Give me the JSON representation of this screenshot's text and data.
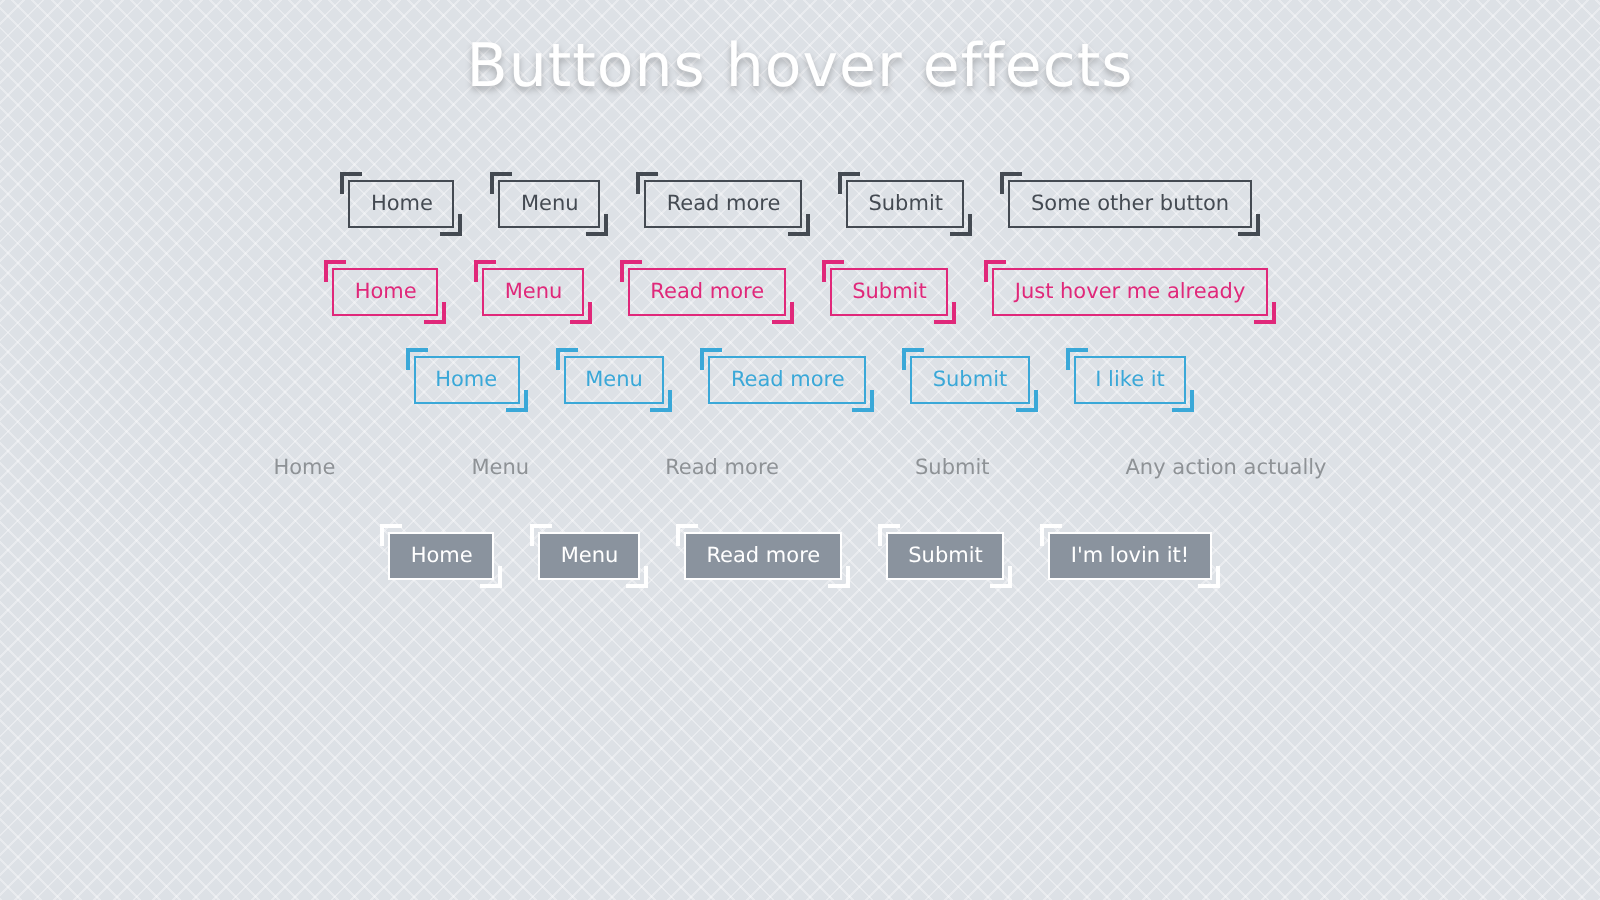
{
  "title": "Buttons hover effects",
  "rows": [
    {
      "kind": "dark",
      "buttons": [
        "Home",
        "Menu",
        "Read more",
        "Submit",
        "Some other button"
      ]
    },
    {
      "kind": "pink",
      "buttons": [
        "Home",
        "Menu",
        "Read more",
        "Submit",
        "Just hover me already"
      ]
    },
    {
      "kind": "blue",
      "buttons": [
        "Home",
        "Menu",
        "Read more",
        "Submit",
        "I like it"
      ]
    },
    {
      "kind": "plain",
      "buttons": [
        "Home",
        "Menu",
        "Read more",
        "Submit",
        "Any action actually"
      ]
    },
    {
      "kind": "white",
      "buttons": [
        "Home",
        "Menu",
        "Read more",
        "Submit",
        "I'm lovin it!"
      ]
    }
  ]
}
